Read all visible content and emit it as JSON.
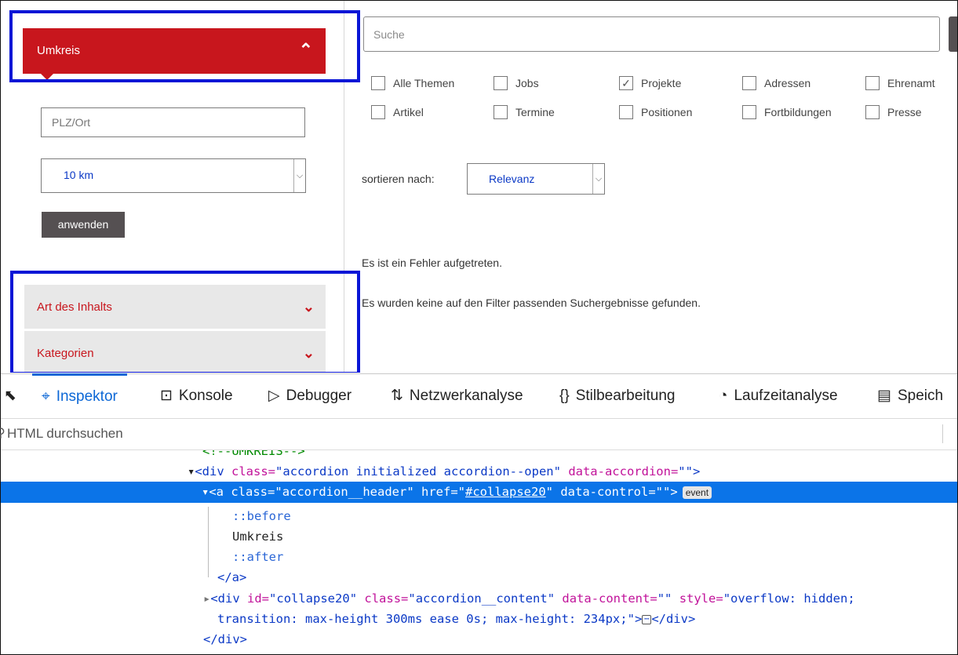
{
  "sidebar": {
    "umkreis_label": "Umkreis",
    "plz_placeholder": "PLZ/Ort",
    "radius_value": "10 km",
    "apply_label": "anwenden",
    "art_label": "Art des Inhalts",
    "kategorien_label": "Kategorien"
  },
  "search": {
    "placeholder": "Suche"
  },
  "filters": [
    {
      "label": "Alle Themen",
      "checked": false
    },
    {
      "label": "Jobs",
      "checked": false
    },
    {
      "label": "Projekte",
      "checked": true
    },
    {
      "label": "Adressen",
      "checked": false
    },
    {
      "label": "Ehrenamt",
      "checked": false
    },
    {
      "label": "Artikel",
      "checked": false
    },
    {
      "label": "Termine",
      "checked": false
    },
    {
      "label": "Positionen",
      "checked": false
    },
    {
      "label": "Fortbildungen",
      "checked": false
    },
    {
      "label": "Presse",
      "checked": false
    }
  ],
  "sort": {
    "label": "sortieren nach:",
    "value": "Relevanz"
  },
  "messages": {
    "error": "Es ist ein Fehler aufgetreten.",
    "no_results": "Es wurden keine auf den Filter passenden Suchergebnisse gefunden."
  },
  "devtools": {
    "tabs": [
      "Inspektor",
      "Konsole",
      "Debugger",
      "Netzwerkanalyse",
      "Stilbearbeitung",
      "Laufzeitanalyse",
      "Speich"
    ],
    "active_tab": "Inspektor",
    "search_placeholder": "HTML durchsuchen",
    "tree": {
      "comment": "<!--UMKREIS-->",
      "div_class": "accordion initialized accordion--open",
      "a_class": "accordion__header",
      "a_href": "#collapse20",
      "event_badge": "event",
      "before": "::before",
      "text": "Umkreis",
      "after": "::after",
      "a_close": "</a>",
      "div2_id": "collapse20",
      "div2_class": "accordion__content",
      "div2_style_1": "overflow: hidden;",
      "div2_style_2": "transition: max-height 300ms ease 0s; max-height: 234px;",
      "div_close": "</div>"
    }
  },
  "colors": {
    "brand_red": "#c8161d",
    "highlight_blue": "#0a16d6",
    "selection": "#0b74e8"
  }
}
